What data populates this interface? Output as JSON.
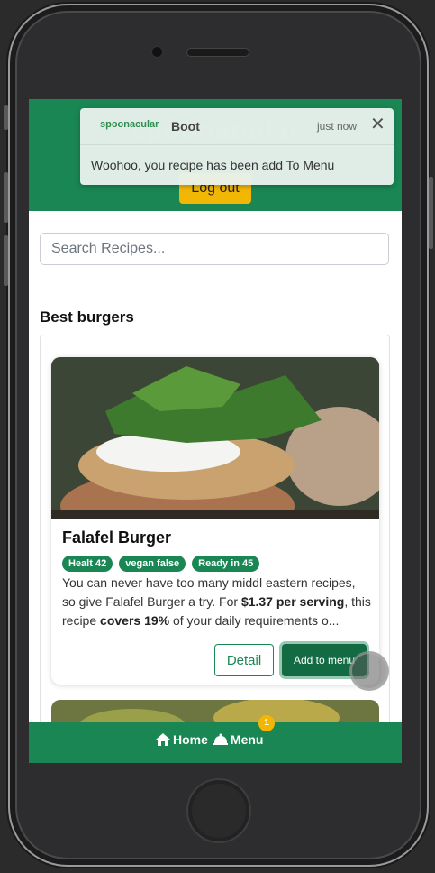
{
  "header": {
    "brand": "spoonacular",
    "logout_label": "Log out"
  },
  "toast": {
    "logo_text": "spoonacular",
    "title": "Boot",
    "time": "just now",
    "close_symbol": "✕",
    "message": "Woohoo, you recipe has been add To Menu"
  },
  "search": {
    "placeholder": "Search Recipes..."
  },
  "section": {
    "title": "Best burgers"
  },
  "recipes": [
    {
      "title": "Falafel Burger",
      "badges": [
        "Healt 42",
        "vegan false",
        "Ready in 45"
      ],
      "desc_part1": "You can never have too many middl eastern recipes, so give Falafel Burger a try. For ",
      "price": "$1.37 per serving",
      "desc_part2": ", this recipe ",
      "covers": "covers 19%",
      "desc_part3": " of your daily requirements o...",
      "detail_label": "Detail",
      "add_label": "Add to menu"
    }
  ],
  "nav": {
    "home_label": "Home",
    "menu_label": "Menu",
    "menu_count": "1"
  },
  "colors": {
    "brand_green": "#1a8654",
    "accent_yellow": "#f2b705"
  }
}
